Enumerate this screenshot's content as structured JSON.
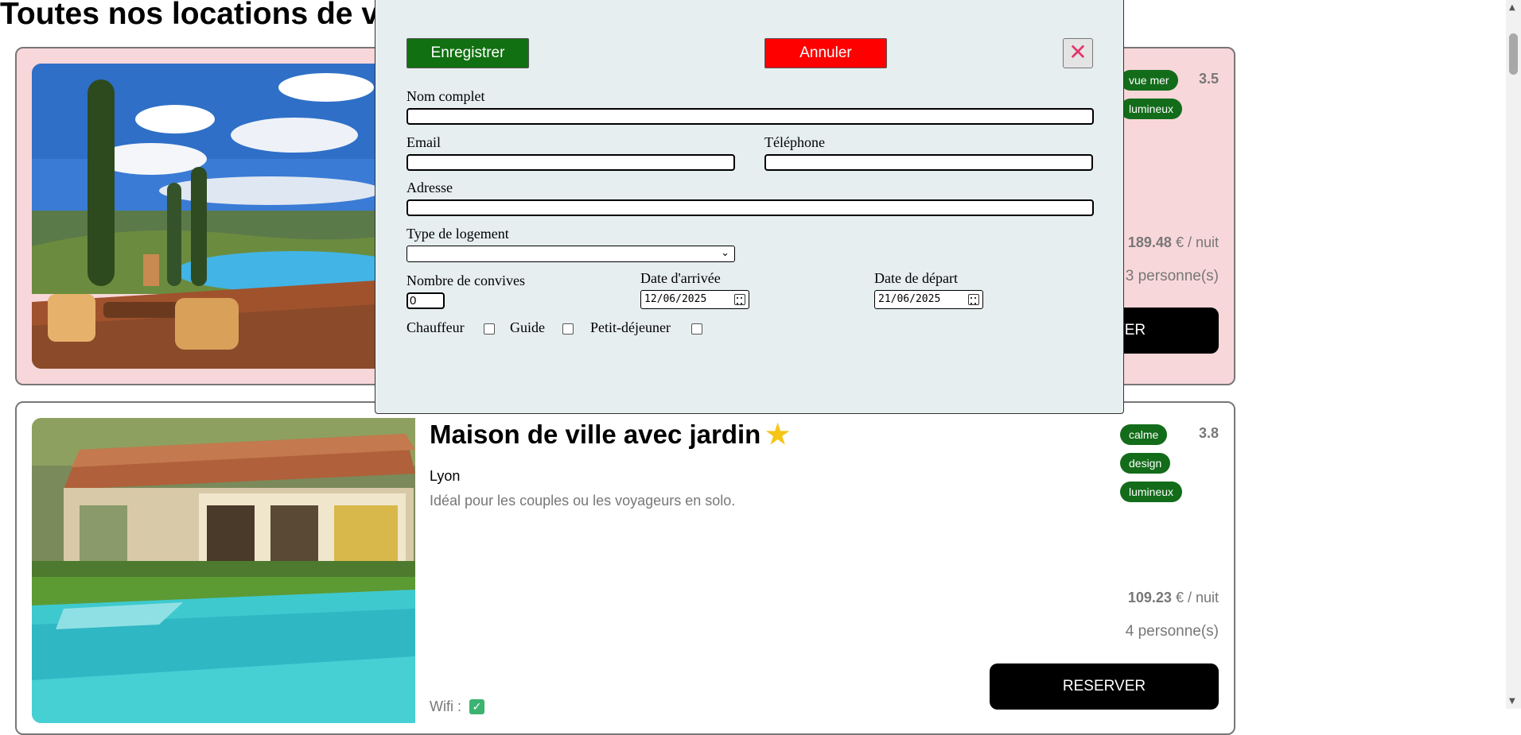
{
  "page": {
    "title": "Toutes nos locations de vacances"
  },
  "listings": [
    {
      "title": "",
      "city": "",
      "description": "",
      "tags": [
        "vue mer",
        "lumineux"
      ],
      "rating": "3.5",
      "price": "189.48",
      "price_suffix": " € / nuit",
      "persons": "3 personne(s)",
      "reserve_label": "RESERVER"
    },
    {
      "title": "Maison de ville avec jardin",
      "star_icon": "star-icon",
      "city": "Lyon",
      "description": "Idéal pour les couples ou les voyageurs en solo.",
      "tags": [
        "calme",
        "design",
        "lumineux"
      ],
      "rating": "3.8",
      "price": "109.23",
      "price_suffix": " € / nuit",
      "persons": "4 personne(s)",
      "reserve_label": "RESERVER",
      "wifi_label": "Wifi :",
      "wifi_checked": true
    }
  ],
  "modal": {
    "save_label": "Enregistrer",
    "cancel_label": "Annuler",
    "close_icon": "close-icon",
    "fields": {
      "full_name_label": "Nom complet",
      "full_name_value": "",
      "email_label": "Email",
      "email_value": "",
      "phone_label": "Téléphone",
      "phone_value": "",
      "address_label": "Adresse",
      "address_value": "",
      "housing_type_label": "Type de logement",
      "housing_type_value": "",
      "guests_label": "Nombre de convives",
      "guests_value": "0",
      "arrival_label": "Date d'arrivée",
      "arrival_value": "12/06/2025",
      "departure_label": "Date de départ",
      "departure_value": "21/06/2025",
      "options": [
        {
          "label": "Chauffeur",
          "checked": false
        },
        {
          "label": "Guide",
          "checked": false
        },
        {
          "label": "Petit-déjeuner",
          "checked": false
        }
      ]
    }
  },
  "colors": {
    "save": "#117011",
    "cancel": "#ff0000",
    "tag": "#136c1a",
    "card_highlight": "#f8d7da",
    "modal_bg": "#e6eef0"
  }
}
